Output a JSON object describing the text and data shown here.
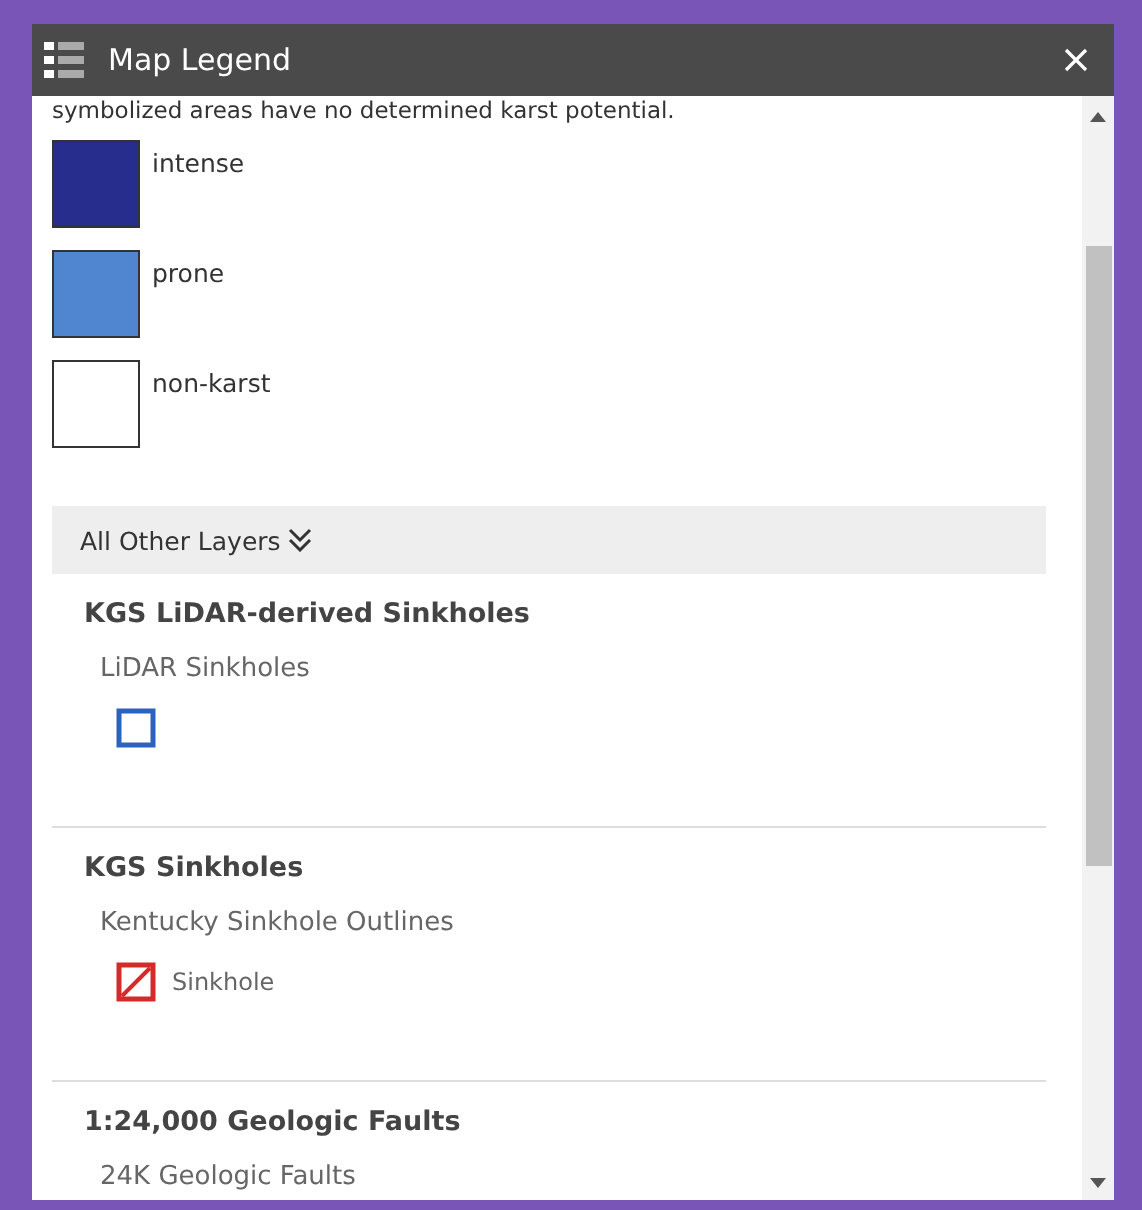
{
  "window": {
    "title": "Map Legend"
  },
  "intro": "symbolized areas have no determined karst potential.",
  "classes": [
    {
      "label": "intense",
      "color": "#272d8c"
    },
    {
      "label": "prone",
      "color": "#4f86cf"
    },
    {
      "label": "non-karst",
      "color": "#ffffff"
    }
  ],
  "section": {
    "label": "All Other Layers",
    "expanded": true
  },
  "layers": [
    {
      "title": "KGS LiDAR-derived Sinkholes",
      "sublayer": "LiDAR Sinkholes",
      "symbol": {
        "kind": "outline"
      }
    },
    {
      "title": "KGS Sinkholes",
      "sublayer": "Kentucky Sinkhole Outlines",
      "symbol": {
        "kind": "hatched",
        "label": "Sinkhole"
      }
    },
    {
      "title": "1:24,000 Geologic Faults",
      "sublayer": "24K Geologic Faults"
    }
  ]
}
